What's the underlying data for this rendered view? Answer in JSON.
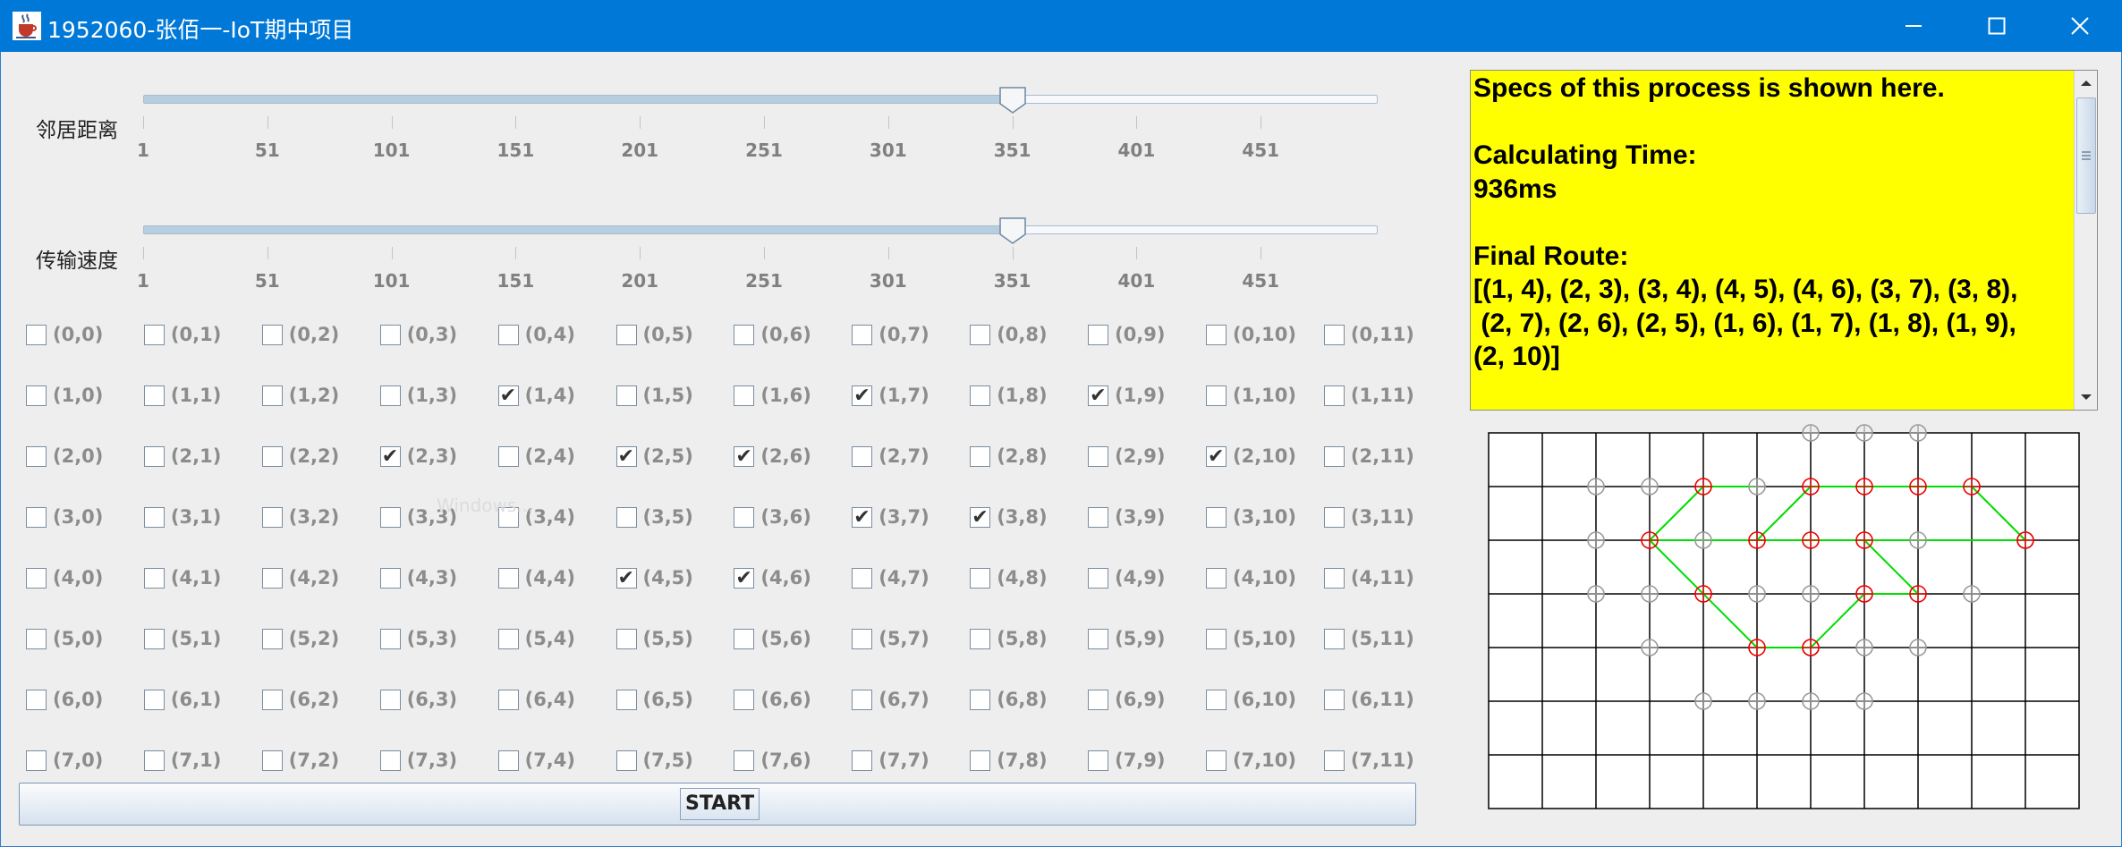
{
  "window": {
    "title": "1952060-张佰一-IoT期中项目",
    "icon": "java-cup-icon",
    "controls": [
      "minimize-icon",
      "maximize-icon",
      "close-icon"
    ]
  },
  "sliders": [
    {
      "label": "邻居距离",
      "value": 351,
      "min": 1,
      "max": 500,
      "tick_labels": [
        "1",
        "51",
        "101",
        "151",
        "201",
        "251",
        "301",
        "351",
        "401",
        "451"
      ]
    },
    {
      "label": "传输速度",
      "value": 351,
      "min": 1,
      "max": 500,
      "tick_labels": [
        "1",
        "51",
        "101",
        "151",
        "201",
        "251",
        "301",
        "351",
        "401",
        "451"
      ]
    }
  ],
  "grid": {
    "rows": 8,
    "cols": 12,
    "checked": [
      [
        1,
        4
      ],
      [
        1,
        7
      ],
      [
        1,
        9
      ],
      [
        2,
        3
      ],
      [
        2,
        5
      ],
      [
        2,
        6
      ],
      [
        2,
        10
      ],
      [
        3,
        7
      ],
      [
        3,
        8
      ],
      [
        4,
        5
      ],
      [
        4,
        6
      ]
    ]
  },
  "watermark_text": "Windows...",
  "start_button": {
    "label": "START"
  },
  "specs": {
    "lines": [
      "Specs of this process is shown here.",
      "",
      "Calculating Time:",
      "936ms",
      "",
      "Final Route:",
      "[(1, 4), (2, 3), (3, 4), (4, 5), (4, 6), (3, 7), (3, 8),",
      " (2, 7), (2, 6), (2, 5), (1, 6), (1, 7), (1, 8), (1, 9),",
      "(2, 10)]"
    ],
    "background": "#ffff00"
  },
  "map": {
    "rows": 7,
    "cols": 11,
    "route_color": "#00dd00",
    "selected_color": "#ee0000",
    "node_color": "#9a9a9a",
    "gray_nodes": [
      [
        0,
        6
      ],
      [
        0,
        7
      ],
      [
        0,
        8
      ],
      [
        1,
        2
      ],
      [
        1,
        3
      ],
      [
        1,
        5
      ],
      [
        2,
        2
      ],
      [
        2,
        4
      ],
      [
        2,
        8
      ],
      [
        2,
        10
      ],
      [
        3,
        2
      ],
      [
        3,
        3
      ],
      [
        3,
        5
      ],
      [
        3,
        6
      ],
      [
        3,
        7
      ],
      [
        3,
        9
      ],
      [
        4,
        3
      ],
      [
        4,
        6
      ],
      [
        4,
        7
      ],
      [
        4,
        8
      ],
      [
        5,
        4
      ],
      [
        5,
        5
      ],
      [
        5,
        6
      ],
      [
        5,
        7
      ]
    ],
    "red_nodes": [
      [
        1,
        4
      ],
      [
        1,
        6
      ],
      [
        1,
        7
      ],
      [
        1,
        8
      ],
      [
        1,
        9
      ],
      [
        2,
        3
      ],
      [
        2,
        5
      ],
      [
        2,
        6
      ],
      [
        2,
        7
      ],
      [
        2,
        10
      ],
      [
        3,
        4
      ],
      [
        3,
        7
      ],
      [
        3,
        8
      ],
      [
        4,
        5
      ],
      [
        4,
        6
      ]
    ],
    "route": [
      [
        2,
        3
      ],
      [
        1,
        4
      ],
      [
        1,
        6
      ],
      [
        1,
        7
      ],
      [
        1,
        8
      ],
      [
        1,
        9
      ],
      [
        2,
        10
      ],
      [
        2,
        3
      ],
      [
        3,
        4
      ],
      [
        4,
        5
      ],
      [
        4,
        6
      ],
      [
        3,
        7
      ],
      [
        3,
        8
      ],
      [
        2,
        7
      ],
      [
        2,
        6
      ],
      [
        2,
        5
      ],
      [
        1,
        6
      ]
    ],
    "route_segments": [
      [
        [
          2,
          3
        ],
        [
          1,
          4
        ]
      ],
      [
        [
          2,
          3
        ],
        [
          3,
          4
        ]
      ],
      [
        [
          3,
          4
        ],
        [
          4,
          5
        ]
      ],
      [
        [
          4,
          5
        ],
        [
          4,
          6
        ]
      ],
      [
        [
          4,
          6
        ],
        [
          3,
          7
        ]
      ],
      [
        [
          3,
          7
        ],
        [
          3,
          8
        ]
      ],
      [
        [
          3,
          8
        ],
        [
          2,
          7
        ]
      ],
      [
        [
          2,
          7
        ],
        [
          2,
          6
        ]
      ],
      [
        [
          2,
          6
        ],
        [
          2,
          5
        ]
      ],
      [
        [
          2,
          5
        ],
        [
          1,
          6
        ]
      ],
      [
        [
          1,
          4
        ],
        [
          1,
          5
        ]
      ],
      [
        [
          1,
          6
        ],
        [
          1,
          7
        ]
      ],
      [
        [
          1,
          7
        ],
        [
          1,
          8
        ]
      ],
      [
        [
          1,
          8
        ],
        [
          1,
          9
        ]
      ],
      [
        [
          1,
          9
        ],
        [
          2,
          10
        ]
      ],
      [
        [
          2,
          10
        ],
        [
          2,
          3
        ]
      ]
    ]
  }
}
